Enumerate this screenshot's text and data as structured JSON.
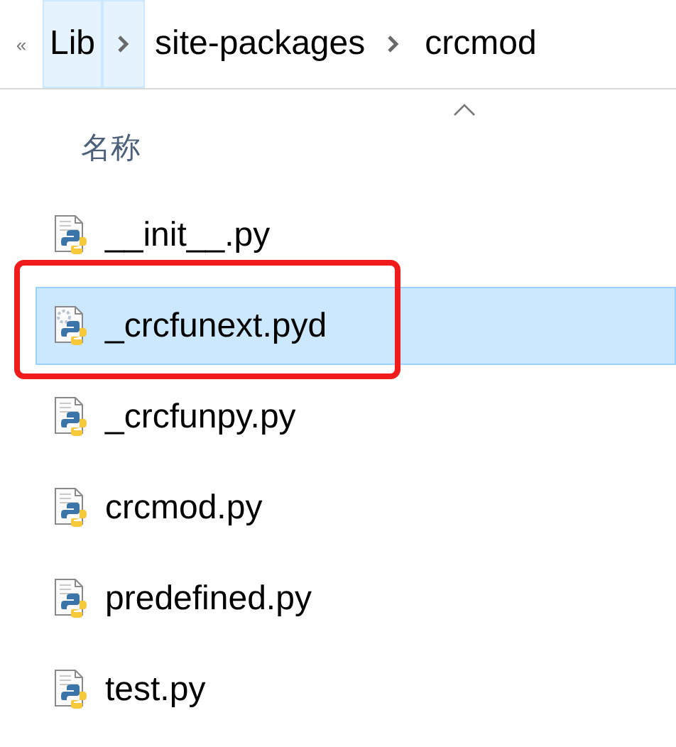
{
  "breadcrumb": {
    "overflow": "«",
    "segments": [
      {
        "label": "Lib",
        "highlighted": true
      },
      {
        "label": "site-packages",
        "highlighted": false
      },
      {
        "label": "crcmod",
        "highlighted": false
      }
    ]
  },
  "column_header": {
    "label": "名称",
    "sort_ascending": true
  },
  "files": [
    {
      "name": "__init__.py",
      "kind": "py",
      "selected": false,
      "marked": false
    },
    {
      "name": "_crcfunext.pyd",
      "kind": "pyd",
      "selected": true,
      "marked": true
    },
    {
      "name": "_crcfunpy.py",
      "kind": "py",
      "selected": false,
      "marked": false
    },
    {
      "name": "crcmod.py",
      "kind": "py",
      "selected": false,
      "marked": false
    },
    {
      "name": "predefined.py",
      "kind": "py",
      "selected": false,
      "marked": false
    },
    {
      "name": "test.py",
      "kind": "py",
      "selected": false,
      "marked": false
    }
  ]
}
